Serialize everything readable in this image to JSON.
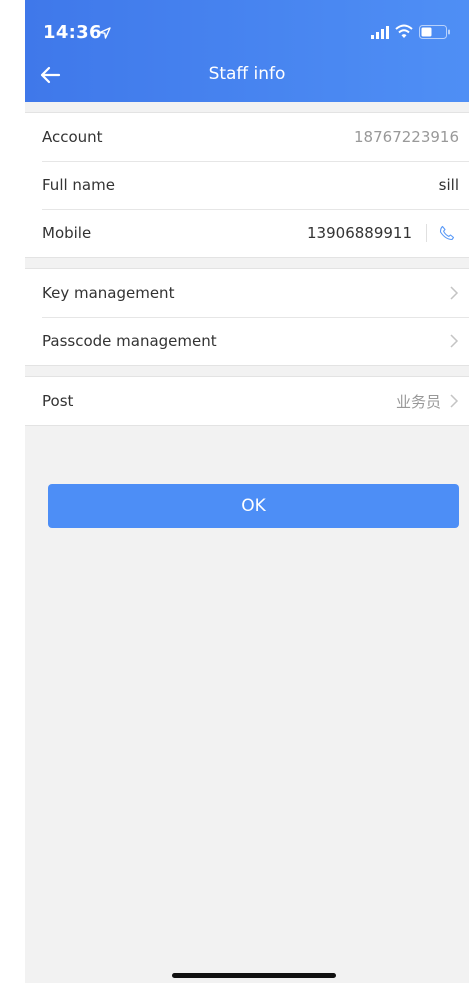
{
  "status_bar": {
    "time": "14:36"
  },
  "header": {
    "title": "Staff info"
  },
  "info": [
    {
      "label": "Account",
      "value": "18767223916"
    },
    {
      "label": "Full name",
      "value": "sill"
    },
    {
      "label": "Mobile",
      "value": "13906889911"
    }
  ],
  "management": [
    {
      "label": "Key management"
    },
    {
      "label": "Passcode management"
    }
  ],
  "post": {
    "label": "Post",
    "value": "业务员"
  },
  "ok_label": "OK",
  "colors": {
    "header": "#4585f0",
    "button": "#4d8ef6",
    "background": "#f2f2f2"
  }
}
